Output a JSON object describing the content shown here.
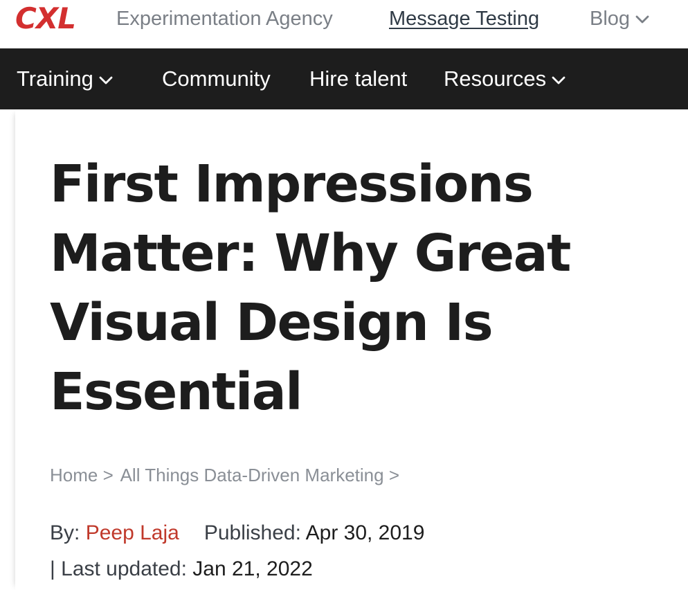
{
  "topbar": {
    "logo": "CXL",
    "links": {
      "agency": "Experimentation Agency",
      "message_testing": "Message Testing",
      "blog": "Blog"
    }
  },
  "nav": {
    "training": "Training",
    "community": "Community",
    "hire_talent": "Hire talent",
    "resources": "Resources"
  },
  "article": {
    "title": "First Impressions Matter: Why Great Visual Design Is Essential",
    "breadcrumb": {
      "home": "Home",
      "category": "All Things Data-Driven Marketing",
      "separator": ">"
    },
    "meta": {
      "by_label": "By:",
      "author": "Peep Laja",
      "published_label": "Published:",
      "published_date": "Apr 30, 2019",
      "updated_label": "| Last updated:",
      "updated_date": "Jan 21, 2022"
    }
  },
  "colors": {
    "brand": "#d32f2f",
    "nav_background": "#1d1d1d",
    "author_link": "#c0392b"
  },
  "icons": {
    "dropdown": "chevron-down-icon"
  }
}
